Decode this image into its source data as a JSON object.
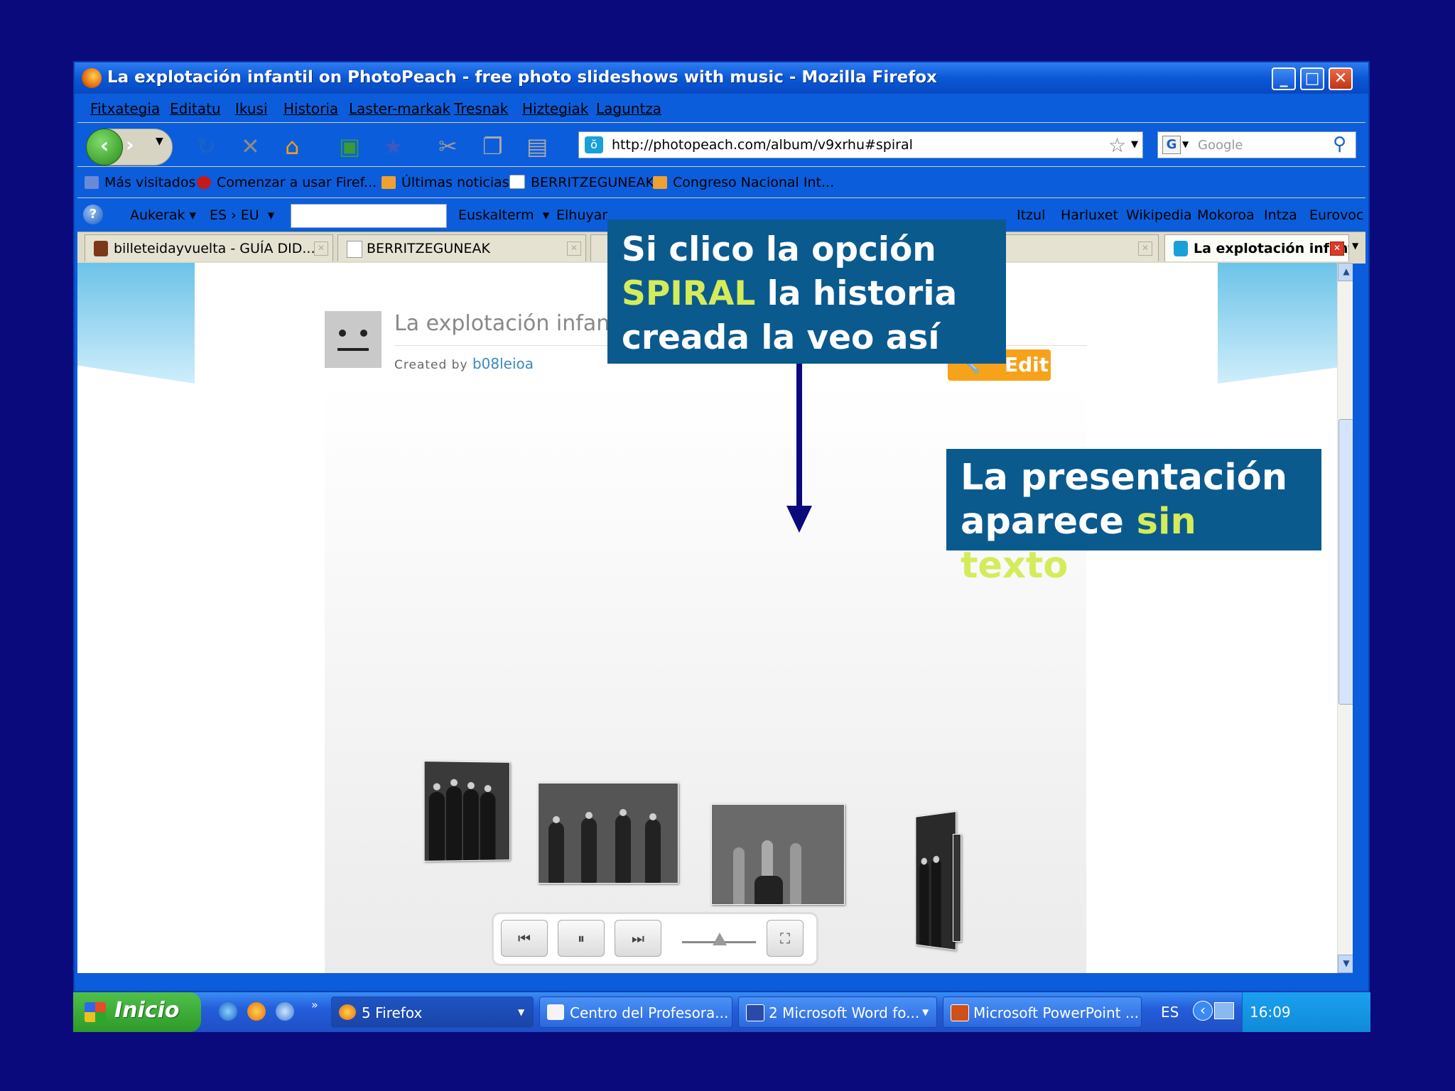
{
  "window": {
    "title": "La explotación infantil on PhotoPeach - free photo slideshows with music - Mozilla Firefox",
    "minimize": "_",
    "maximize": "□",
    "close": "✕"
  },
  "menu": [
    "Fitxategia",
    "Editatu",
    "Ikusi",
    "Historia",
    "Laster-markak",
    "Tresnak",
    "Hiztegiak",
    "Laguntza"
  ],
  "nav": {
    "url": "http://photopeach.com/album/v9xrhu#spiral",
    "search_placeholder": "Google",
    "back_icon": "back-arrow-icon",
    "reload_icon": "reload-icon"
  },
  "bookmarks": [
    "Más visitados",
    "Comenzar a usar Firef...",
    "Últimas noticias",
    "BERRITZEGUNEAK",
    "Congreso Nacional Int..."
  ],
  "toolbar2": {
    "aukerak": "Aukerak",
    "lang": "ES › EU",
    "euskalterm": "Euskalterm",
    "elhuyar": "Elhuyar",
    "right_links": [
      "Itzul",
      "Harluxet",
      "Wikipedia",
      "Mokoroa",
      "Intza",
      "Eurovoc"
    ]
  },
  "tabs": [
    {
      "label": "billeteidayvuelta - GUÍA DID..."
    },
    {
      "label": "BERRITZEGUNEAK"
    },
    {
      "label": "La explotación infantil o..."
    }
  ],
  "page": {
    "album_title": "La explotación infan",
    "created_by": "Created by",
    "author": "b08leioa",
    "edit_label": "Edit"
  },
  "callouts": {
    "top": {
      "line1": "Si clico la opción",
      "highlight": "SPIRAL",
      "rest2": " la historia",
      "line3": "creada la veo así"
    },
    "right": {
      "line1": "La presentación",
      "line2_prefix": "aparece ",
      "highlight": "sin texto"
    },
    "accent_color": "#d4ec5a",
    "box_color": "#0a5a8e"
  },
  "taskbar": {
    "start": "Inicio",
    "tasks": [
      "5 Firefox",
      "Centro del Profesora...",
      "2 Microsoft Word fo...",
      "Microsoft PowerPoint ..."
    ],
    "lang": "ES",
    "time": "16:09"
  }
}
